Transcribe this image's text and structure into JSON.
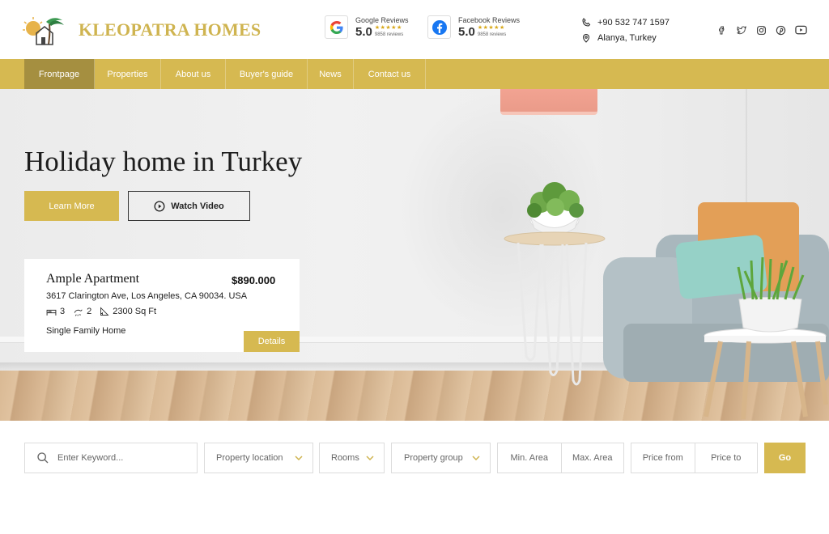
{
  "brand": {
    "name": "KLEOPATRA HOMES",
    "accent_color": "#d6b951",
    "accent_dark": "#a58f40",
    "logo_icon": "palm-house-logo"
  },
  "reviews": [
    {
      "source": "Google Reviews",
      "score": "5.0",
      "stars": "★★★★★",
      "count": "9858 reviews",
      "icon": "google-icon"
    },
    {
      "source": "Facebook Reviews",
      "score": "5.0",
      "stars": "★★★★★",
      "count": "9858 reviews",
      "icon": "facebook-icon"
    }
  ],
  "contact": {
    "phone": "+90 532 747 1597",
    "location": "Alanya, Turkey"
  },
  "social": [
    "facebook-icon",
    "twitter-icon",
    "instagram-icon",
    "pinterest-icon",
    "youtube-icon"
  ],
  "nav": {
    "items": [
      "Frontpage",
      "Properties",
      "About us",
      "Buyer's guide",
      "News",
      "Contact us"
    ],
    "active": "Frontpage"
  },
  "hero": {
    "title": "Holiday home in Turkey",
    "learn_more": "Learn More",
    "watch_video": "Watch Video"
  },
  "listing": {
    "name": "Ample Apartment",
    "price": "$890.000",
    "address": "3617 Clarington Ave, Los Angeles, CA 90034. USA",
    "beds": "3",
    "baths": "2",
    "area": "2300 Sq Ft",
    "type": "Single Family Home",
    "details_label": "Details"
  },
  "search": {
    "keyword_placeholder": "Enter Keyword...",
    "location": "Property location",
    "rooms": "Rooms",
    "group": "Property group",
    "min_area": "Min. Area",
    "max_area": "Max. Area",
    "price_from": "Price from",
    "price_to": "Price to",
    "go": "Go"
  }
}
